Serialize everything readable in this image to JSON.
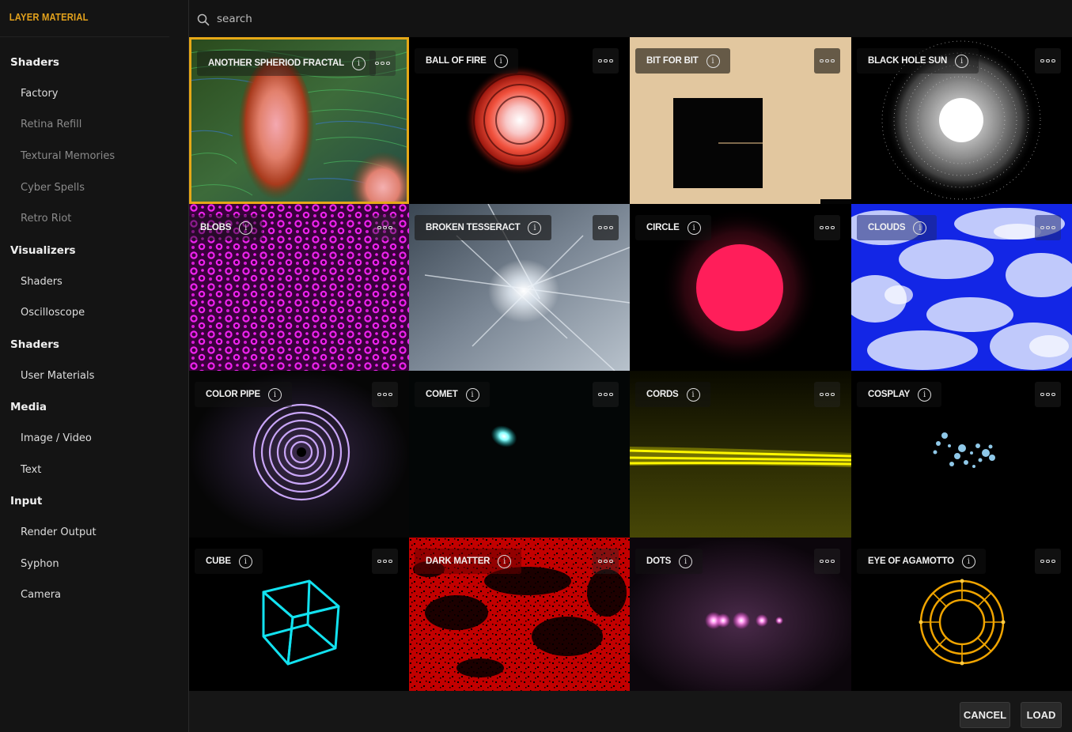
{
  "app": {
    "title": "LAYER MATERIAL"
  },
  "search": {
    "placeholder": "search"
  },
  "nav": {
    "s1": "Shaders",
    "i_factory": "Factory",
    "i_retina": "Retina Refill",
    "i_textural": "Textural Memories",
    "i_cyber": "Cyber Spells",
    "i_retro": "Retro Riot",
    "s2": "Visualizers",
    "i_vshaders": "Shaders",
    "i_osc": "Oscilloscope",
    "s3": "Shaders",
    "i_user": "User Materials",
    "s4": "Media",
    "i_image": "Image / Video",
    "i_text": "Text",
    "s5": "Input",
    "i_render": "Render Output",
    "i_syphon": "Syphon",
    "i_camera": "Camera"
  },
  "materials": [
    {
      "name": "ANOTHER SPHERIOD FRACTAL"
    },
    {
      "name": "BALL OF FIRE"
    },
    {
      "name": "BIT FOR BIT"
    },
    {
      "name": "BLACK HOLE SUN"
    },
    {
      "name": "BLOBS"
    },
    {
      "name": "BROKEN TESSERACT"
    },
    {
      "name": "CIRCLE"
    },
    {
      "name": "CLOUDS"
    },
    {
      "name": "COLOR PIPE"
    },
    {
      "name": "COMET"
    },
    {
      "name": "CORDS"
    },
    {
      "name": "COSPLAY"
    },
    {
      "name": "CUBE"
    },
    {
      "name": "DARK MATTER"
    },
    {
      "name": "DOTS"
    },
    {
      "name": "EYE OF AGAMOTTO"
    }
  ],
  "footer": {
    "cancel": "CANCEL",
    "load": "LOAD"
  },
  "icons": {
    "info": "info-icon",
    "more": "more-icon",
    "search": "search-icon"
  },
  "colors": {
    "accent": "#e6a817"
  }
}
